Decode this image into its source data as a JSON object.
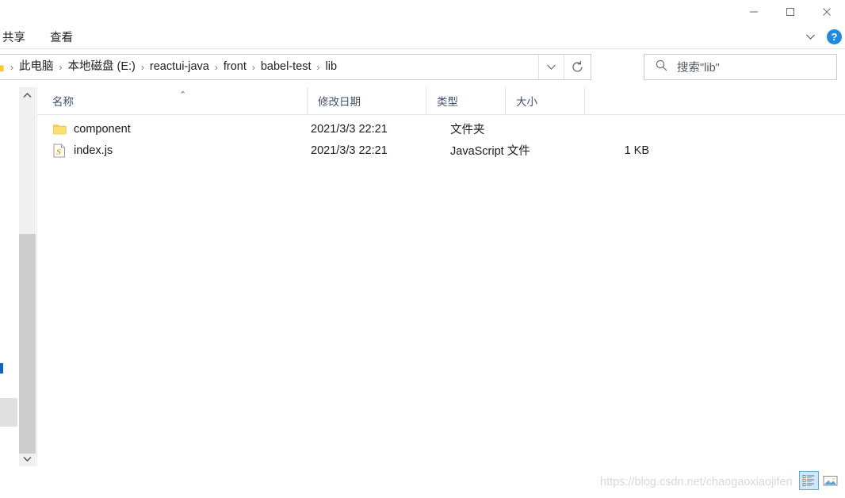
{
  "window": {
    "controls": {
      "minimize_label": "最小化",
      "maximize_label": "最大化",
      "close_label": "关闭"
    }
  },
  "ribbon": {
    "tabs": [
      {
        "label": "共享"
      },
      {
        "label": "查看"
      }
    ],
    "collapse_label": "折叠功能区",
    "help_label": "?"
  },
  "address_bar": {
    "crumbs": [
      {
        "label": "此电脑"
      },
      {
        "label": "本地磁盘 (E:)"
      },
      {
        "label": "reactui-java"
      },
      {
        "label": "front"
      },
      {
        "label": "babel-test"
      },
      {
        "label": "lib"
      }
    ],
    "separator": "›",
    "dropdown_label": "最近使用的位置",
    "refresh_label": "刷新"
  },
  "search": {
    "placeholder": "搜索\"lib\"",
    "value": ""
  },
  "columns": [
    {
      "key": "name",
      "label": "名称",
      "sorted": true,
      "sort_caret": "⌃"
    },
    {
      "key": "date",
      "label": "修改日期"
    },
    {
      "key": "type",
      "label": "类型"
    },
    {
      "key": "size",
      "label": "大小"
    }
  ],
  "files": [
    {
      "name": "component",
      "date": "2021/3/3 22:21",
      "type": "文件夹",
      "size": "",
      "icon": "folder-icon"
    },
    {
      "name": "index.js",
      "date": "2021/3/3 22:21",
      "type": "JavaScript 文件",
      "size": "1 KB",
      "icon": "javascript-file-icon"
    }
  ],
  "status_bar": {
    "watermark": "https://blog.csdn.net/chaogaoxiaojifen",
    "view_buttons": [
      {
        "name": "details-view",
        "label": "详细信息",
        "active": true
      },
      {
        "name": "large-icons-view",
        "label": "大图标",
        "active": false
      }
    ]
  },
  "colors": {
    "accent": "#1d8ae0",
    "folder_yellow": "#ffd14a",
    "selection_blue": "#cfe8f7",
    "header_text": "#41506b",
    "watermark": "#d4d9de"
  }
}
